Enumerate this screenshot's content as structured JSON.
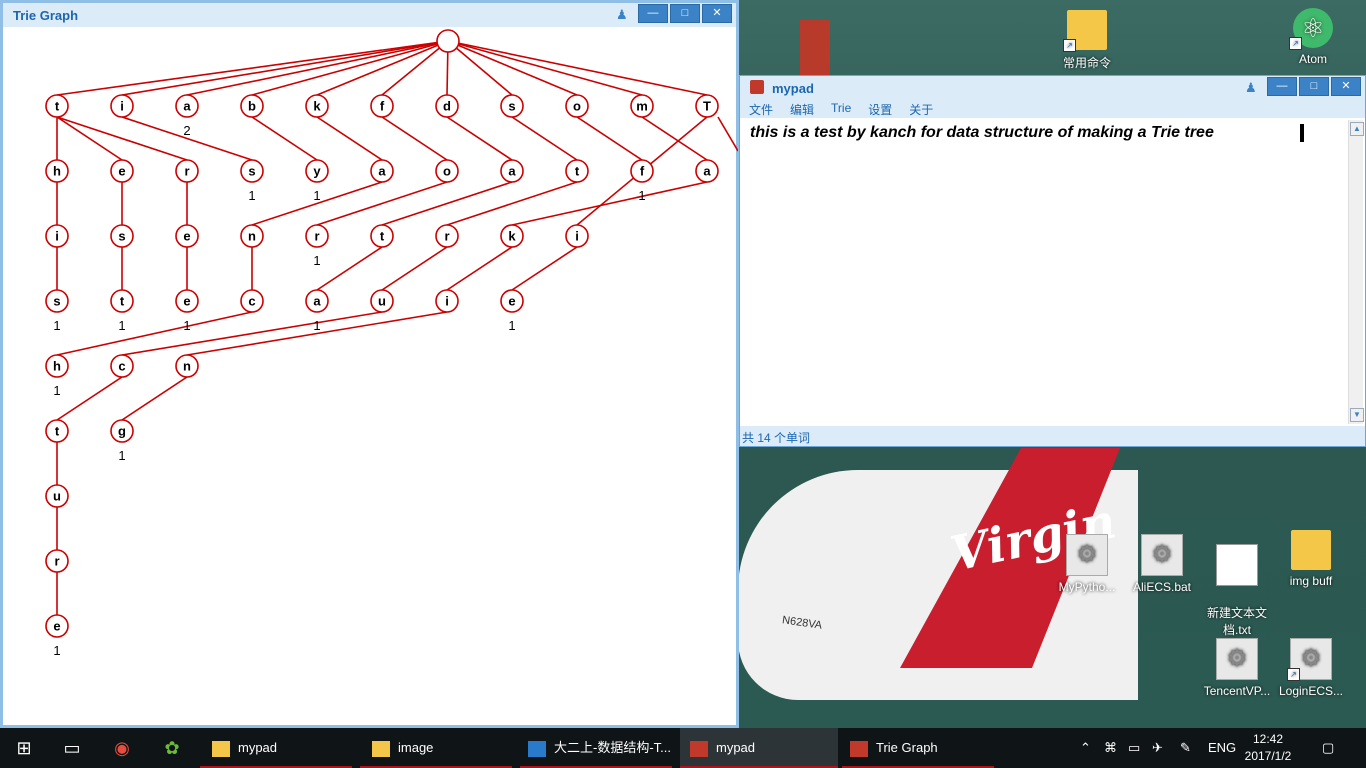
{
  "trie_window": {
    "title": "Trie Graph",
    "root": {
      "label": ""
    },
    "nodes": [
      {
        "id": "t",
        "label": "t",
        "count": ""
      },
      {
        "id": "i",
        "label": "i",
        "count": ""
      },
      {
        "id": "a",
        "label": "a",
        "count": "2"
      },
      {
        "id": "b",
        "label": "b",
        "count": ""
      },
      {
        "id": "k",
        "label": "k",
        "count": ""
      },
      {
        "id": "f",
        "label": "f",
        "count": ""
      },
      {
        "id": "d",
        "label": "d",
        "count": ""
      },
      {
        "id": "s",
        "label": "s",
        "count": ""
      },
      {
        "id": "o",
        "label": "o",
        "count": ""
      },
      {
        "id": "m",
        "label": "m",
        "count": ""
      },
      {
        "id": "T",
        "label": "T",
        "count": ""
      },
      {
        "id": "th",
        "label": "h",
        "count": ""
      },
      {
        "id": "te",
        "label": "e",
        "count": ""
      },
      {
        "id": "tr",
        "label": "r",
        "count": ""
      },
      {
        "id": "is",
        "label": "s",
        "count": "1"
      },
      {
        "id": "by",
        "label": "y",
        "count": "1"
      },
      {
        "id": "ka",
        "label": "a",
        "count": ""
      },
      {
        "id": "fo",
        "label": "o",
        "count": ""
      },
      {
        "id": "da",
        "label": "a",
        "count": ""
      },
      {
        "id": "st",
        "label": "t",
        "count": ""
      },
      {
        "id": "of",
        "label": "f",
        "count": "1"
      },
      {
        "id": "ma",
        "label": "a",
        "count": ""
      },
      {
        "id": "thi",
        "label": "i",
        "count": ""
      },
      {
        "id": "tes",
        "label": "s",
        "count": ""
      },
      {
        "id": "tre",
        "label": "e",
        "count": ""
      },
      {
        "id": "kan",
        "label": "n",
        "count": ""
      },
      {
        "id": "for",
        "label": "r",
        "count": "1"
      },
      {
        "id": "dat",
        "label": "t",
        "count": ""
      },
      {
        "id": "str",
        "label": "r",
        "count": ""
      },
      {
        "id": "mak",
        "label": "k",
        "count": ""
      },
      {
        "id": "Tri",
        "label": "i",
        "count": ""
      },
      {
        "id": "this",
        "label": "s",
        "count": "1"
      },
      {
        "id": "test",
        "label": "t",
        "count": "1"
      },
      {
        "id": "tree",
        "label": "e",
        "count": "1"
      },
      {
        "id": "kanc",
        "label": "c",
        "count": ""
      },
      {
        "id": "data",
        "label": "a",
        "count": "1"
      },
      {
        "id": "stru",
        "label": "u",
        "count": ""
      },
      {
        "id": "maki",
        "label": "i",
        "count": ""
      },
      {
        "id": "Trie",
        "label": "e",
        "count": "1"
      },
      {
        "id": "kanch",
        "label": "h",
        "count": "1"
      },
      {
        "id": "struc",
        "label": "c",
        "count": ""
      },
      {
        "id": "makin",
        "label": "n",
        "count": ""
      },
      {
        "id": "struct",
        "label": "t",
        "count": ""
      },
      {
        "id": "making",
        "label": "g",
        "count": "1"
      },
      {
        "id": "structu",
        "label": "u",
        "count": ""
      },
      {
        "id": "structur",
        "label": "r",
        "count": ""
      },
      {
        "id": "structure",
        "label": "e",
        "count": "1"
      }
    ],
    "edges": [
      [
        "root",
        "t"
      ],
      [
        "root",
        "i"
      ],
      [
        "root",
        "a"
      ],
      [
        "root",
        "b"
      ],
      [
        "root",
        "k"
      ],
      [
        "root",
        "f"
      ],
      [
        "root",
        "d"
      ],
      [
        "root",
        "s"
      ],
      [
        "root",
        "o"
      ],
      [
        "root",
        "m"
      ],
      [
        "root",
        "T"
      ],
      [
        "t",
        "th"
      ],
      [
        "t",
        "te"
      ],
      [
        "t",
        "tr"
      ],
      [
        "i",
        "is"
      ],
      [
        "b",
        "by"
      ],
      [
        "k",
        "ka"
      ],
      [
        "f",
        "fo"
      ],
      [
        "d",
        "da"
      ],
      [
        "s",
        "st"
      ],
      [
        "o",
        "of"
      ],
      [
        "m",
        "ma"
      ],
      [
        "th",
        "thi"
      ],
      [
        "te",
        "tes"
      ],
      [
        "tr",
        "tre"
      ],
      [
        "ka",
        "kan"
      ],
      [
        "fo",
        "for"
      ],
      [
        "da",
        "dat"
      ],
      [
        "st",
        "str"
      ],
      [
        "ma",
        "mak"
      ],
      [
        "T",
        "Tri"
      ],
      [
        "thi",
        "this"
      ],
      [
        "tes",
        "test"
      ],
      [
        "tre",
        "tree"
      ],
      [
        "kan",
        "kanc"
      ],
      [
        "dat",
        "data"
      ],
      [
        "str",
        "stru"
      ],
      [
        "mak",
        "maki"
      ],
      [
        "Tri",
        "Trie"
      ],
      [
        "kanc",
        "kanch"
      ],
      [
        "stru",
        "struc"
      ],
      [
        "maki",
        "makin"
      ],
      [
        "struc",
        "struct"
      ],
      [
        "makin",
        "making"
      ],
      [
        "struct",
        "structu"
      ],
      [
        "structu",
        "structur"
      ],
      [
        "structur",
        "structure"
      ]
    ],
    "colors": {
      "node": "#cc0000",
      "edge": "#cc0000"
    }
  },
  "pad_window": {
    "title": "mypad",
    "menu": [
      "文件",
      "编辑",
      "Trie",
      "设置",
      "关于"
    ],
    "text": "this is a test by kanch for data structure of making a Trie tree",
    "status": "共 14 个单词"
  },
  "desktop_icons": [
    {
      "label": "常用命令",
      "icon": "folder-icon"
    },
    {
      "label": "Atom",
      "icon": "atom-icon"
    },
    {
      "label": "MyPytho...",
      "icon": "gear-file-icon"
    },
    {
      "label": "AliECS.bat",
      "icon": "gear-file-icon"
    },
    {
      "label": "新建文本文\n档.txt",
      "icon": "text-file-icon"
    },
    {
      "label": "img buff",
      "icon": "folder-icon"
    },
    {
      "label": "TencentVP...",
      "icon": "gear-file-icon"
    },
    {
      "label": "LoginECS...",
      "icon": "gear-file-icon"
    }
  ],
  "wallpaper": {
    "logo_text": "Virgin",
    "registration": "N628VA"
  },
  "taskbar": {
    "apps": [
      {
        "label": "mypad",
        "icon": "folder-icon"
      },
      {
        "label": "image",
        "icon": "folder-icon"
      },
      {
        "label": "大二上-数据结构-T...",
        "icon": "vscode-icon"
      },
      {
        "label": "mypad",
        "icon": "app-icon"
      },
      {
        "label": "Trie Graph",
        "icon": "app-icon"
      }
    ],
    "language": "ENG",
    "time": "12:42",
    "date": "2017/1/2"
  }
}
